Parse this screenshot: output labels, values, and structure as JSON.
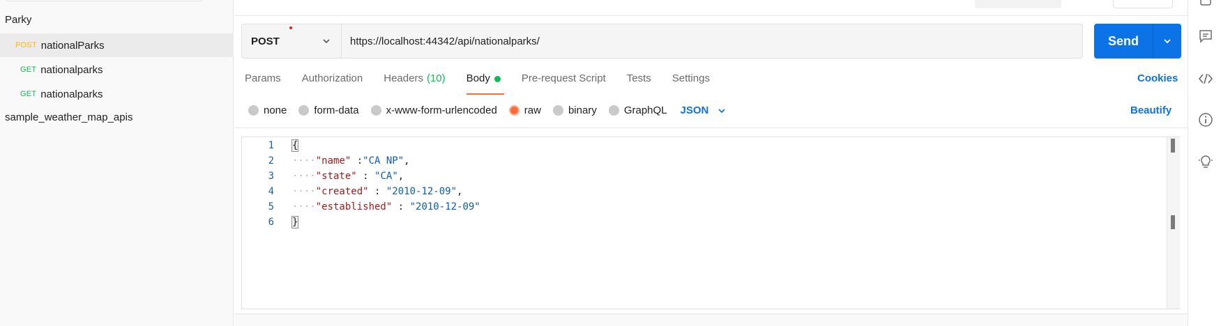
{
  "sidebar": {
    "collection": "Parky",
    "requests": [
      {
        "method": "POST",
        "name": "nationalParks",
        "active": true
      },
      {
        "method": "GET",
        "name": "nationalparks",
        "active": false
      },
      {
        "method": "GET",
        "name": "nationalparks",
        "active": false
      }
    ],
    "collection2": "sample_weather_map_apis"
  },
  "request": {
    "method": "POST",
    "url": "https://localhost:44342/api/nationalparks/",
    "send_label": "Send"
  },
  "tabs": [
    {
      "label": "Params"
    },
    {
      "label": "Authorization"
    },
    {
      "label": "Headers",
      "count": "(10)"
    },
    {
      "label": "Body",
      "active": true
    },
    {
      "label": "Pre-request Script"
    },
    {
      "label": "Tests"
    },
    {
      "label": "Settings"
    }
  ],
  "cookies_label": "Cookies",
  "body_options": {
    "modes": [
      "none",
      "form-data",
      "x-www-form-urlencoded",
      "raw",
      "binary",
      "GraphQL"
    ],
    "selected": "raw",
    "language": "JSON",
    "beautify_label": "Beautify"
  },
  "editor": {
    "lines": [
      {
        "n": "1",
        "text": "{"
      },
      {
        "n": "2",
        "key": "\"name\"",
        "sep": " :",
        "value": "\"CA NP\"",
        "tail": ","
      },
      {
        "n": "3",
        "key": "\"state\"",
        "sep": " : ",
        "value": "\"CA\"",
        "tail": ","
      },
      {
        "n": "4",
        "key": "\"created\"",
        "sep": " : ",
        "value": "\"2010-12-09\"",
        "tail": ","
      },
      {
        "n": "5",
        "key": "\"established\"",
        "sep": " : ",
        "value": "\"2010-12-09\"",
        "tail": ""
      },
      {
        "n": "6",
        "text": "}"
      }
    ]
  },
  "colors": {
    "accent": "#0c73e6",
    "post": "#ffb400",
    "get": "#0cbb52",
    "active_tab": "#ff6c37"
  },
  "rail_icons": [
    "comment-icon",
    "code-icon",
    "info-icon",
    "lightbulb-icon"
  ]
}
